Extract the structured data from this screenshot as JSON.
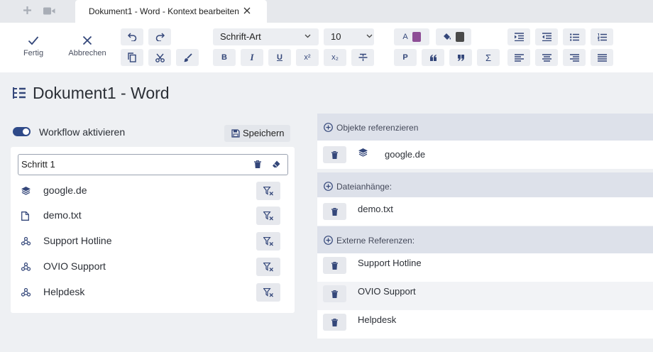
{
  "tab": {
    "title": "Dokument1 - Word - Kontext bearbeiten",
    "icons": [
      "plus-icon",
      "video-icon",
      "close-icon"
    ]
  },
  "toolbar": {
    "done_label": "Fertig",
    "cancel_label": "Abbrechen",
    "font_family": "Schrift-Art",
    "font_size": "10",
    "paragraph_label": "P",
    "sum_label": "Σ",
    "bold_label": "B",
    "italic_label": "I",
    "underline_label": "U",
    "superscript_label": "x²",
    "subscript_label": "x₂",
    "text_color_label": "A",
    "text_color": "#8e4e96",
    "fill_color": "#4a4a4a"
  },
  "page": {
    "title": "Dokument1 - Word"
  },
  "workflow": {
    "toggle_label": "Workflow aktivieren",
    "enabled": true,
    "save_label": "Speichern",
    "step_name": "Schritt 1",
    "items": [
      {
        "icon": "layers-icon",
        "label": "google.de"
      },
      {
        "icon": "file-icon",
        "label": "demo.txt"
      },
      {
        "icon": "webhook-icon",
        "label": "Support Hotline"
      },
      {
        "icon": "webhook-icon",
        "label": "OVIO Support"
      },
      {
        "icon": "webhook-icon",
        "label": "Helpdesk"
      }
    ]
  },
  "references": {
    "objects_header": "Objekte referenzieren",
    "objects": [
      {
        "label": "google.de",
        "icon": "layers-icon"
      }
    ],
    "attachments_header": "Dateianhänge:",
    "attachments": [
      {
        "label": "demo.txt"
      }
    ],
    "external_header": "Externe Referenzen:",
    "external": [
      {
        "label": "Support Hotline"
      },
      {
        "label": "OVIO Support"
      },
      {
        "label": "Helpdesk"
      }
    ]
  },
  "colors": {
    "accent": "#2f4a89",
    "icon": "#34477a",
    "section_bg": "#dde1ea",
    "page_bg": "#eef0f3"
  }
}
